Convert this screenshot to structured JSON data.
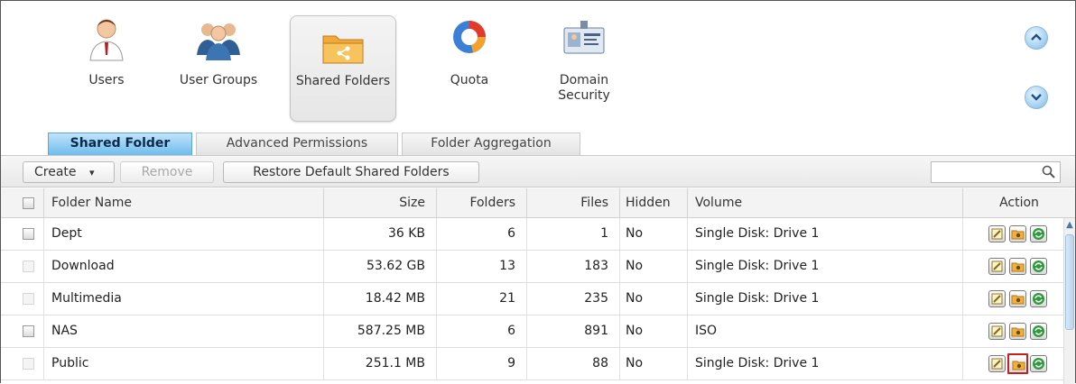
{
  "nav": {
    "items": [
      {
        "label": "Users",
        "icon": "user-icon"
      },
      {
        "label": "User Groups",
        "icon": "user-group-icon"
      },
      {
        "label": "Shared Folders",
        "icon": "shared-folder-icon",
        "active": true
      },
      {
        "label": "Quota",
        "icon": "quota-pie-icon"
      },
      {
        "label": "Domain Security",
        "icon": "domain-security-icon"
      }
    ],
    "scroll_up": "^",
    "scroll_down": "v"
  },
  "tabs": [
    {
      "label": "Shared Folder",
      "active": true
    },
    {
      "label": "Advanced Permissions"
    },
    {
      "label": "Folder Aggregation"
    }
  ],
  "toolbar": {
    "create_label": "Create",
    "create_caret": "▾",
    "remove_label": "Remove",
    "restore_label": "Restore Default Shared Folders",
    "search_value": "",
    "search_icon": "magnifier-icon"
  },
  "table": {
    "columns": [
      "Folder Name",
      "Size",
      "Folders",
      "Files",
      "Hidden",
      "Volume",
      "Action"
    ],
    "rows": [
      {
        "name": "Dept",
        "size": "36 KB",
        "folders": "6",
        "files": "1",
        "hidden": "No",
        "volume": "Single Disk: Drive 1",
        "checkbox_enabled": true
      },
      {
        "name": "Download",
        "size": "53.62 GB",
        "folders": "13",
        "files": "183",
        "hidden": "No",
        "volume": "Single Disk: Drive 1",
        "checkbox_enabled": false
      },
      {
        "name": "Multimedia",
        "size": "18.42 MB",
        "folders": "21",
        "files": "235",
        "hidden": "No",
        "volume": "Single Disk: Drive 1",
        "checkbox_enabled": false
      },
      {
        "name": "NAS",
        "size": "587.25 MB",
        "folders": "6",
        "files": "891",
        "hidden": "No",
        "volume": "ISO",
        "checkbox_enabled": true
      },
      {
        "name": "Public",
        "size": "251.1 MB",
        "folders": "9",
        "files": "88",
        "hidden": "No",
        "volume": "Single Disk: Drive 1",
        "checkbox_enabled": false
      }
    ],
    "action_icons": [
      "edit-properties-icon",
      "folder-permission-icon",
      "refresh-icon"
    ],
    "highlighted_action": {
      "row": 4,
      "icon": "folder-permission-icon"
    }
  },
  "colors": {
    "active_tab": "#6fbcec",
    "highlight_border": "#c42020",
    "refresh_green": "#2f9a3c",
    "edit_yellow": "#e7c54a"
  }
}
